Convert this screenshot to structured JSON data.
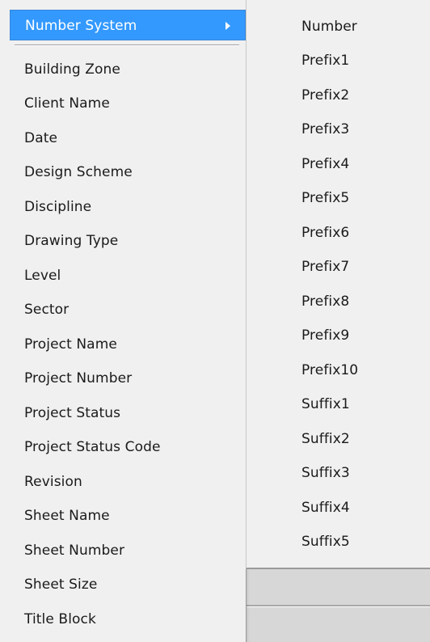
{
  "menu": {
    "highlighted_item": "Number System",
    "items": [
      "Building Zone",
      "Client Name",
      "Date",
      "Design Scheme",
      "Discipline",
      "Drawing Type",
      "Level",
      "Sector",
      "Project Name",
      "Project Number",
      "Project Status",
      "Project Status Code",
      "Revision",
      "Sheet Name",
      "Sheet Number",
      "Sheet Size",
      "Title Block"
    ]
  },
  "submenu": {
    "items": [
      "Number",
      "Prefix1",
      "Prefix2",
      "Prefix3",
      "Prefix4",
      "Prefix5",
      "Prefix6",
      "Prefix7",
      "Prefix8",
      "Prefix9",
      "Prefix10",
      "Suffix1",
      "Suffix2",
      "Suffix3",
      "Suffix4",
      "Suffix5"
    ]
  },
  "colors": {
    "highlight": "#3399ff",
    "menu_background": "#f0f0f0"
  },
  "icons": {
    "submenu_indicator": "chevron-right-icon"
  }
}
